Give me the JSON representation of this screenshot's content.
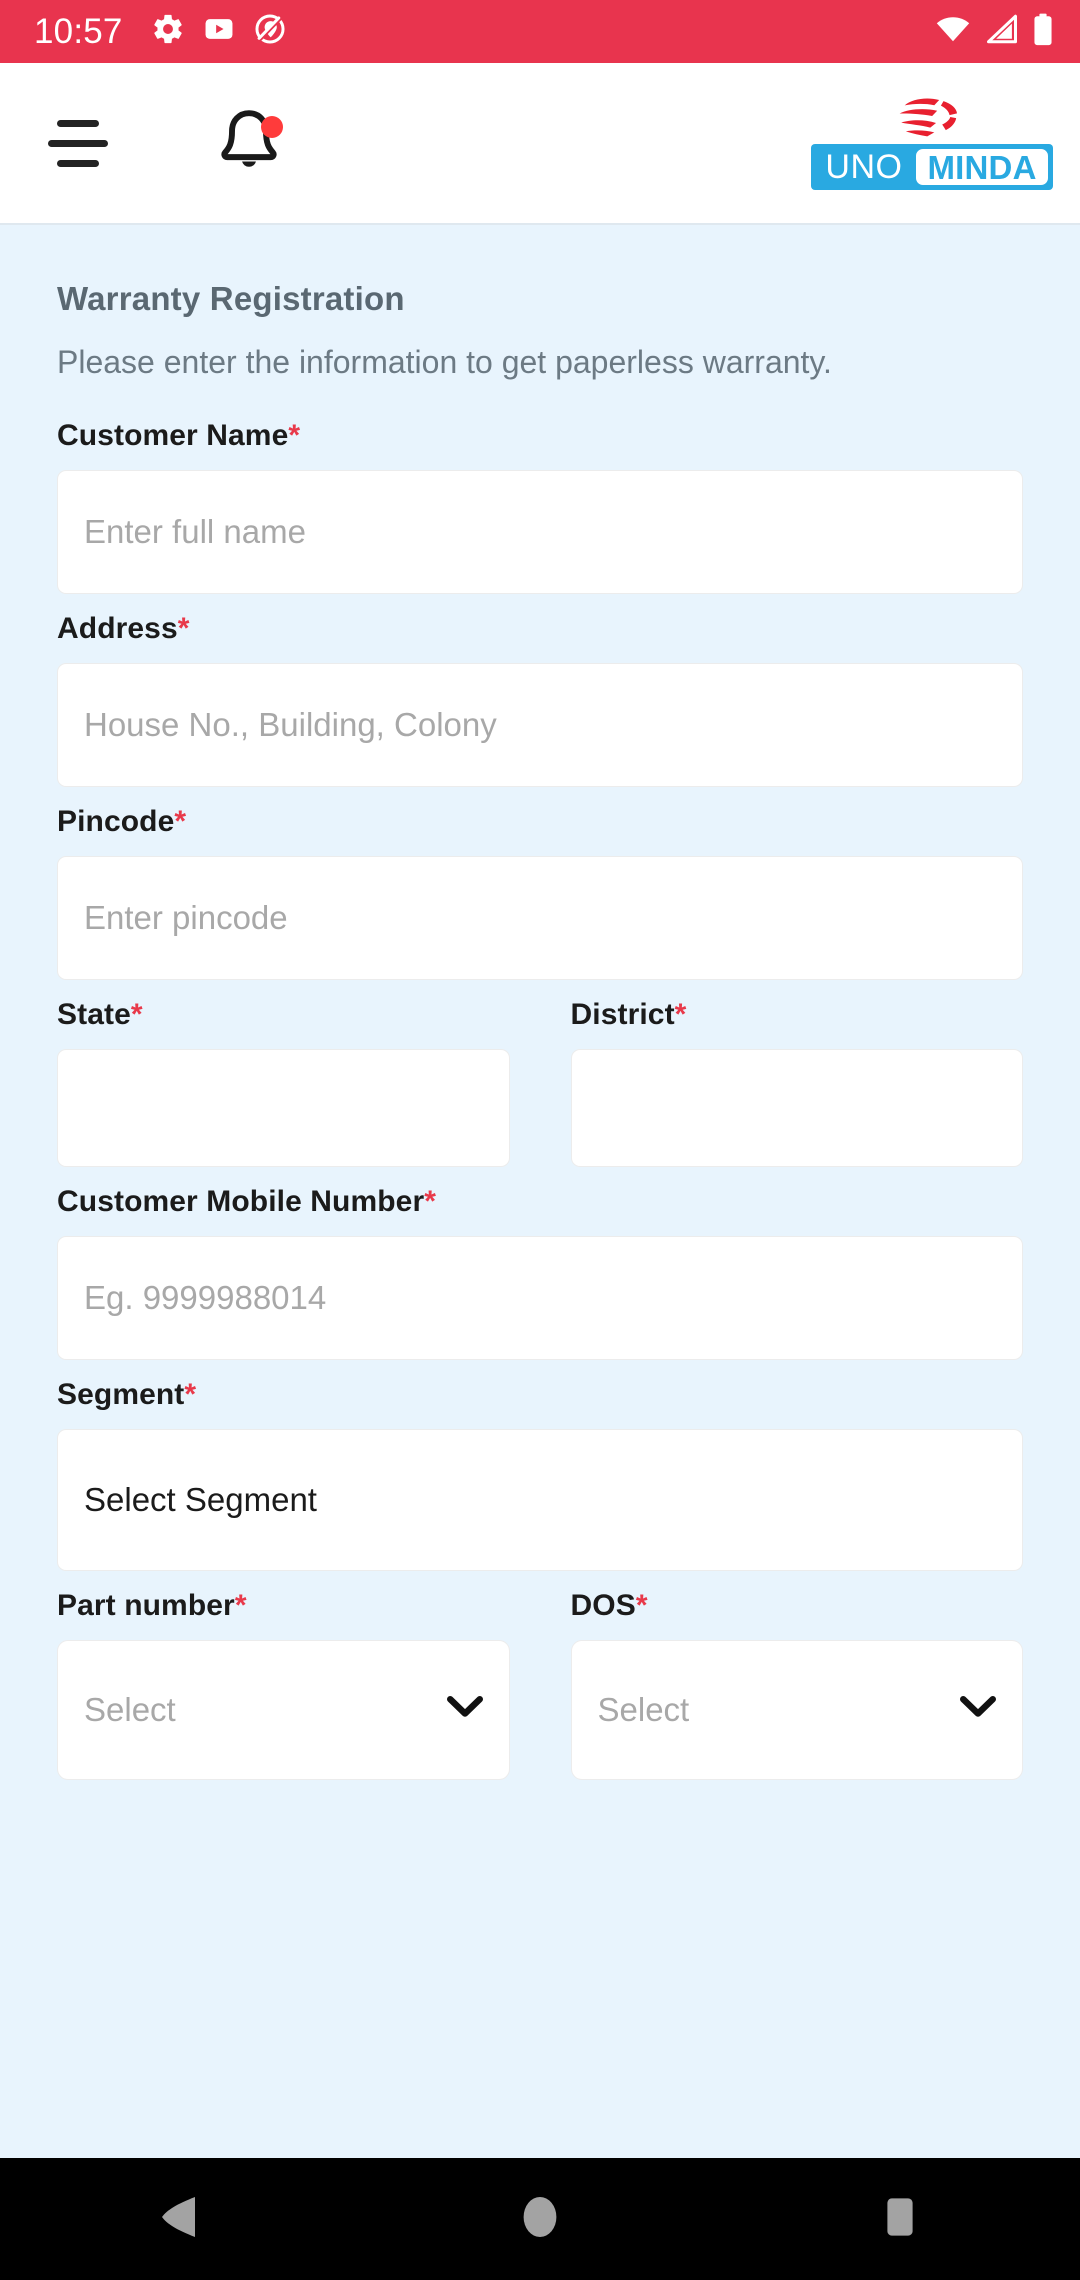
{
  "status_bar": {
    "time": "10:57",
    "background_color": "#e8344e",
    "left_icons": [
      "gear-icon",
      "youtube-icon",
      "no-location-icon"
    ],
    "right_icons": [
      "wifi-icon",
      "cellular-signal-icon",
      "battery-icon"
    ]
  },
  "header": {
    "menu_icon": "hamburger-menu-icon",
    "notification_icon": "bell-icon",
    "notification_badge": true,
    "logo": {
      "primary_text": "UNO",
      "secondary_text": "MINDA",
      "brand_blue": "#29a9e1",
      "swoosh_red": "#e8202f"
    }
  },
  "main": {
    "title": "Warranty Registration",
    "subtitle": "Please enter the information to get paperless warranty.",
    "required_marker": "*",
    "required_color": "#e8394a",
    "fields": {
      "customer_name": {
        "label": "Customer Name",
        "placeholder": "Enter full name",
        "value": ""
      },
      "address": {
        "label": "Address",
        "placeholder": "House No., Building, Colony",
        "value": ""
      },
      "pincode": {
        "label": "Pincode",
        "placeholder": "Enter pincode",
        "value": ""
      },
      "state": {
        "label": "State",
        "placeholder": "",
        "value": ""
      },
      "district": {
        "label": "District",
        "placeholder": "",
        "value": ""
      },
      "mobile": {
        "label": "Customer Mobile Number",
        "placeholder": "Eg. 9999988014",
        "value": ""
      },
      "segment": {
        "label": "Segment",
        "selected": "Select Segment"
      },
      "part_number": {
        "label": "Part number",
        "placeholder": "Select",
        "value": ""
      },
      "dos": {
        "label": "DOS",
        "placeholder": "Select",
        "value": ""
      }
    }
  },
  "nav_bar": {
    "back": "back-triangle-icon",
    "home": "home-circle-icon",
    "recents": "recents-square-icon"
  }
}
